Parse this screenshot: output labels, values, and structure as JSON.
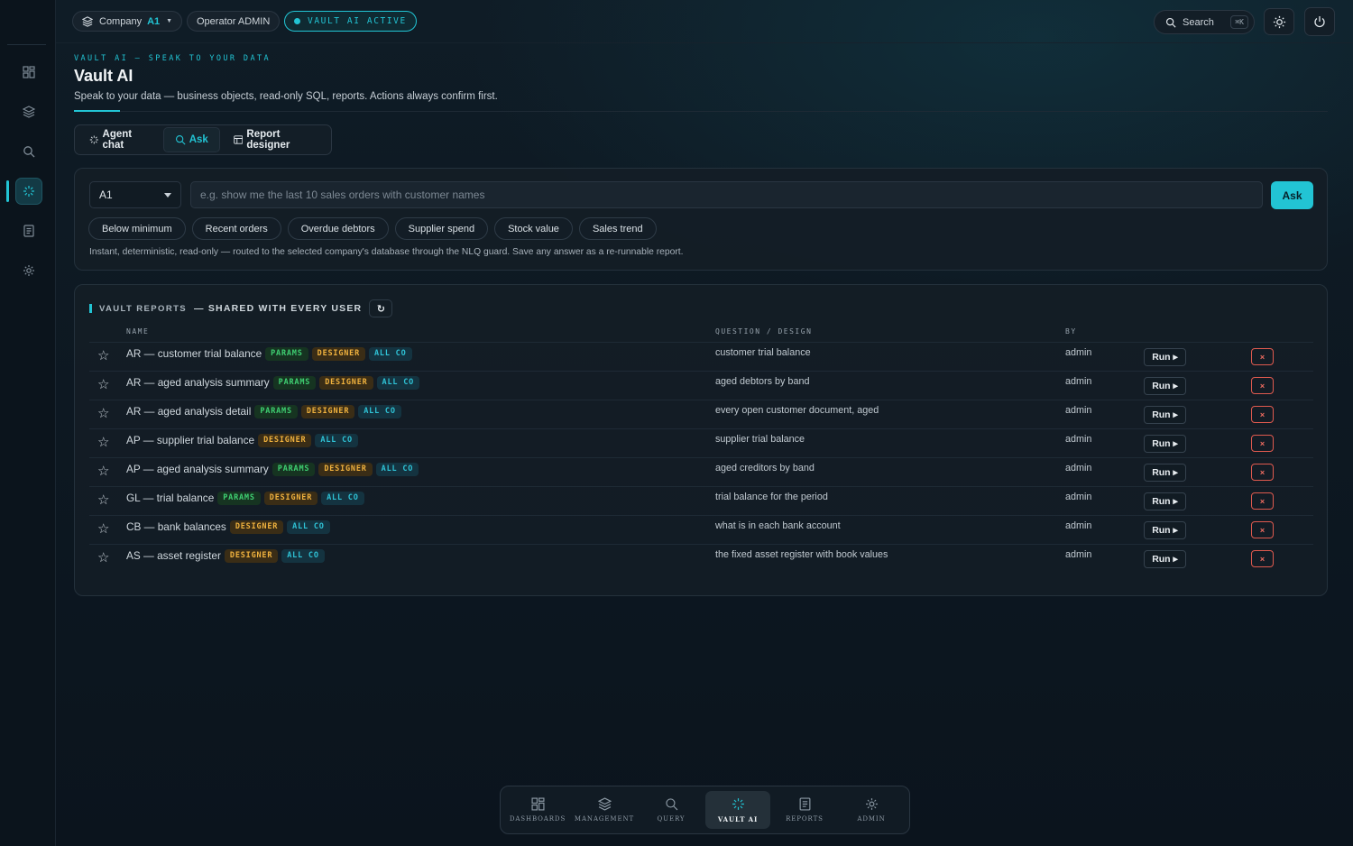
{
  "topbar": {
    "company_label": "Company",
    "company_code": "A1",
    "operator": "Operator ADMIN",
    "vault_status": "VAULT AI ACTIVE",
    "search_label": "Search",
    "search_shortcut": "⌘K"
  },
  "page": {
    "eyebrow": "VAULT AI — SPEAK TO YOUR DATA",
    "title": "Vault AI",
    "subtitle": "Speak to your data — business objects, read-only SQL, reports. Actions always confirm first."
  },
  "tabs": [
    {
      "label": "Agent chat",
      "icon": "sparkle-icon",
      "active": false
    },
    {
      "label": "Ask",
      "icon": "search-icon",
      "active": true
    },
    {
      "label": "Report designer",
      "icon": "layout-icon",
      "active": false
    }
  ],
  "ask": {
    "company_select": "A1",
    "placeholder": "e.g. show me the last 10 sales orders with customer names",
    "button": "Ask",
    "chips": [
      "Below minimum",
      "Recent orders",
      "Overdue debtors",
      "Supplier spend",
      "Stock value",
      "Sales trend"
    ],
    "hint": "Instant, deterministic, read-only — routed to the selected company's database through the NLQ guard. Save any answer as a re-runnable report."
  },
  "reports": {
    "title": "VAULT REPORTS",
    "subtitle": "— SHARED WITH EVERY USER",
    "refresh": "↻",
    "columns": {
      "name": "NAME",
      "question": "QUESTION / DESIGN",
      "by": "BY"
    },
    "run_label": "Run ▸",
    "delete_label": "×",
    "tag_labels": {
      "params": "PARAMS",
      "designer": "DESIGNER",
      "allco": "ALL CO"
    },
    "rows": [
      {
        "name": "AR — customer trial balance",
        "params": true,
        "question": "customer trial balance",
        "by": "admin"
      },
      {
        "name": "AR — aged analysis summary",
        "params": true,
        "question": "aged debtors by band",
        "by": "admin"
      },
      {
        "name": "AR — aged analysis detail",
        "params": true,
        "question": "every open customer document, aged",
        "by": "admin"
      },
      {
        "name": "AP — supplier trial balance",
        "params": false,
        "question": "supplier trial balance",
        "by": "admin"
      },
      {
        "name": "AP — aged analysis summary",
        "params": true,
        "question": "aged creditors by band",
        "by": "admin"
      },
      {
        "name": "GL — trial balance",
        "params": true,
        "question": "trial balance for the period",
        "by": "admin"
      },
      {
        "name": "CB — bank balances",
        "params": false,
        "question": "what is in each bank account",
        "by": "admin"
      },
      {
        "name": "AS — asset register",
        "params": false,
        "question": "the fixed asset register with book values",
        "by": "admin"
      }
    ]
  },
  "dock": [
    {
      "label": "DASHBOARDS",
      "icon": "grid-icon",
      "active": false
    },
    {
      "label": "MANAGEMENT",
      "icon": "layers-icon",
      "active": false
    },
    {
      "label": "QUERY",
      "icon": "search-icon",
      "active": false
    },
    {
      "label": "VAULT AI",
      "icon": "sparkle-icon",
      "active": true
    },
    {
      "label": "REPORTS",
      "icon": "document-icon",
      "active": false
    },
    {
      "label": "ADMIN",
      "icon": "gear-icon",
      "active": false
    }
  ],
  "colors": {
    "accent": "#22c4d4",
    "params": "#3fcf72",
    "designer": "#f0b23e",
    "danger": "#e05a4f",
    "background": "#0c1620"
  }
}
